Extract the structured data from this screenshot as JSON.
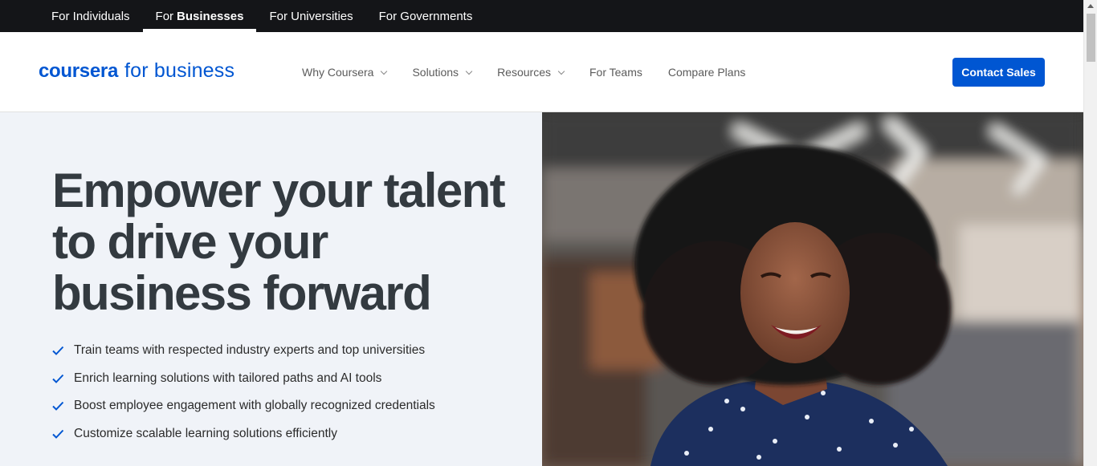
{
  "audience_tabs": [
    {
      "label": "For Individuals"
    },
    {
      "label_prefix": "For",
      "label_bold": "Businesses",
      "active": true
    },
    {
      "label": "For Universities"
    },
    {
      "label": "For Governments"
    }
  ],
  "header": {
    "logo_brand": "coursera",
    "logo_suffix": "for business",
    "nav": [
      {
        "label": "Why Coursera",
        "has_dropdown": true
      },
      {
        "label": "Solutions",
        "has_dropdown": true
      },
      {
        "label": "Resources",
        "has_dropdown": true
      },
      {
        "label": "For Teams",
        "has_dropdown": false
      },
      {
        "label": "Compare Plans",
        "has_dropdown": false
      }
    ],
    "cta_label": "Contact Sales"
  },
  "hero": {
    "title_lines": [
      "Empower your talent",
      "to drive your",
      "business forward"
    ],
    "benefits": [
      "Train teams with respected industry experts and top universities",
      "Enrich learning solutions with tailored paths and AI tools",
      "Boost employee engagement with globally recognized credentials",
      "Customize scalable learning solutions efficiently"
    ]
  },
  "colors": {
    "brand_blue": "#0056d2",
    "audience_bar": "#141518",
    "hero_bg": "#f0f3f8",
    "headline": "#333a40"
  },
  "icons": {
    "benefit_bullet": "check-icon",
    "nav_dropdown": "chevron-down-icon"
  }
}
